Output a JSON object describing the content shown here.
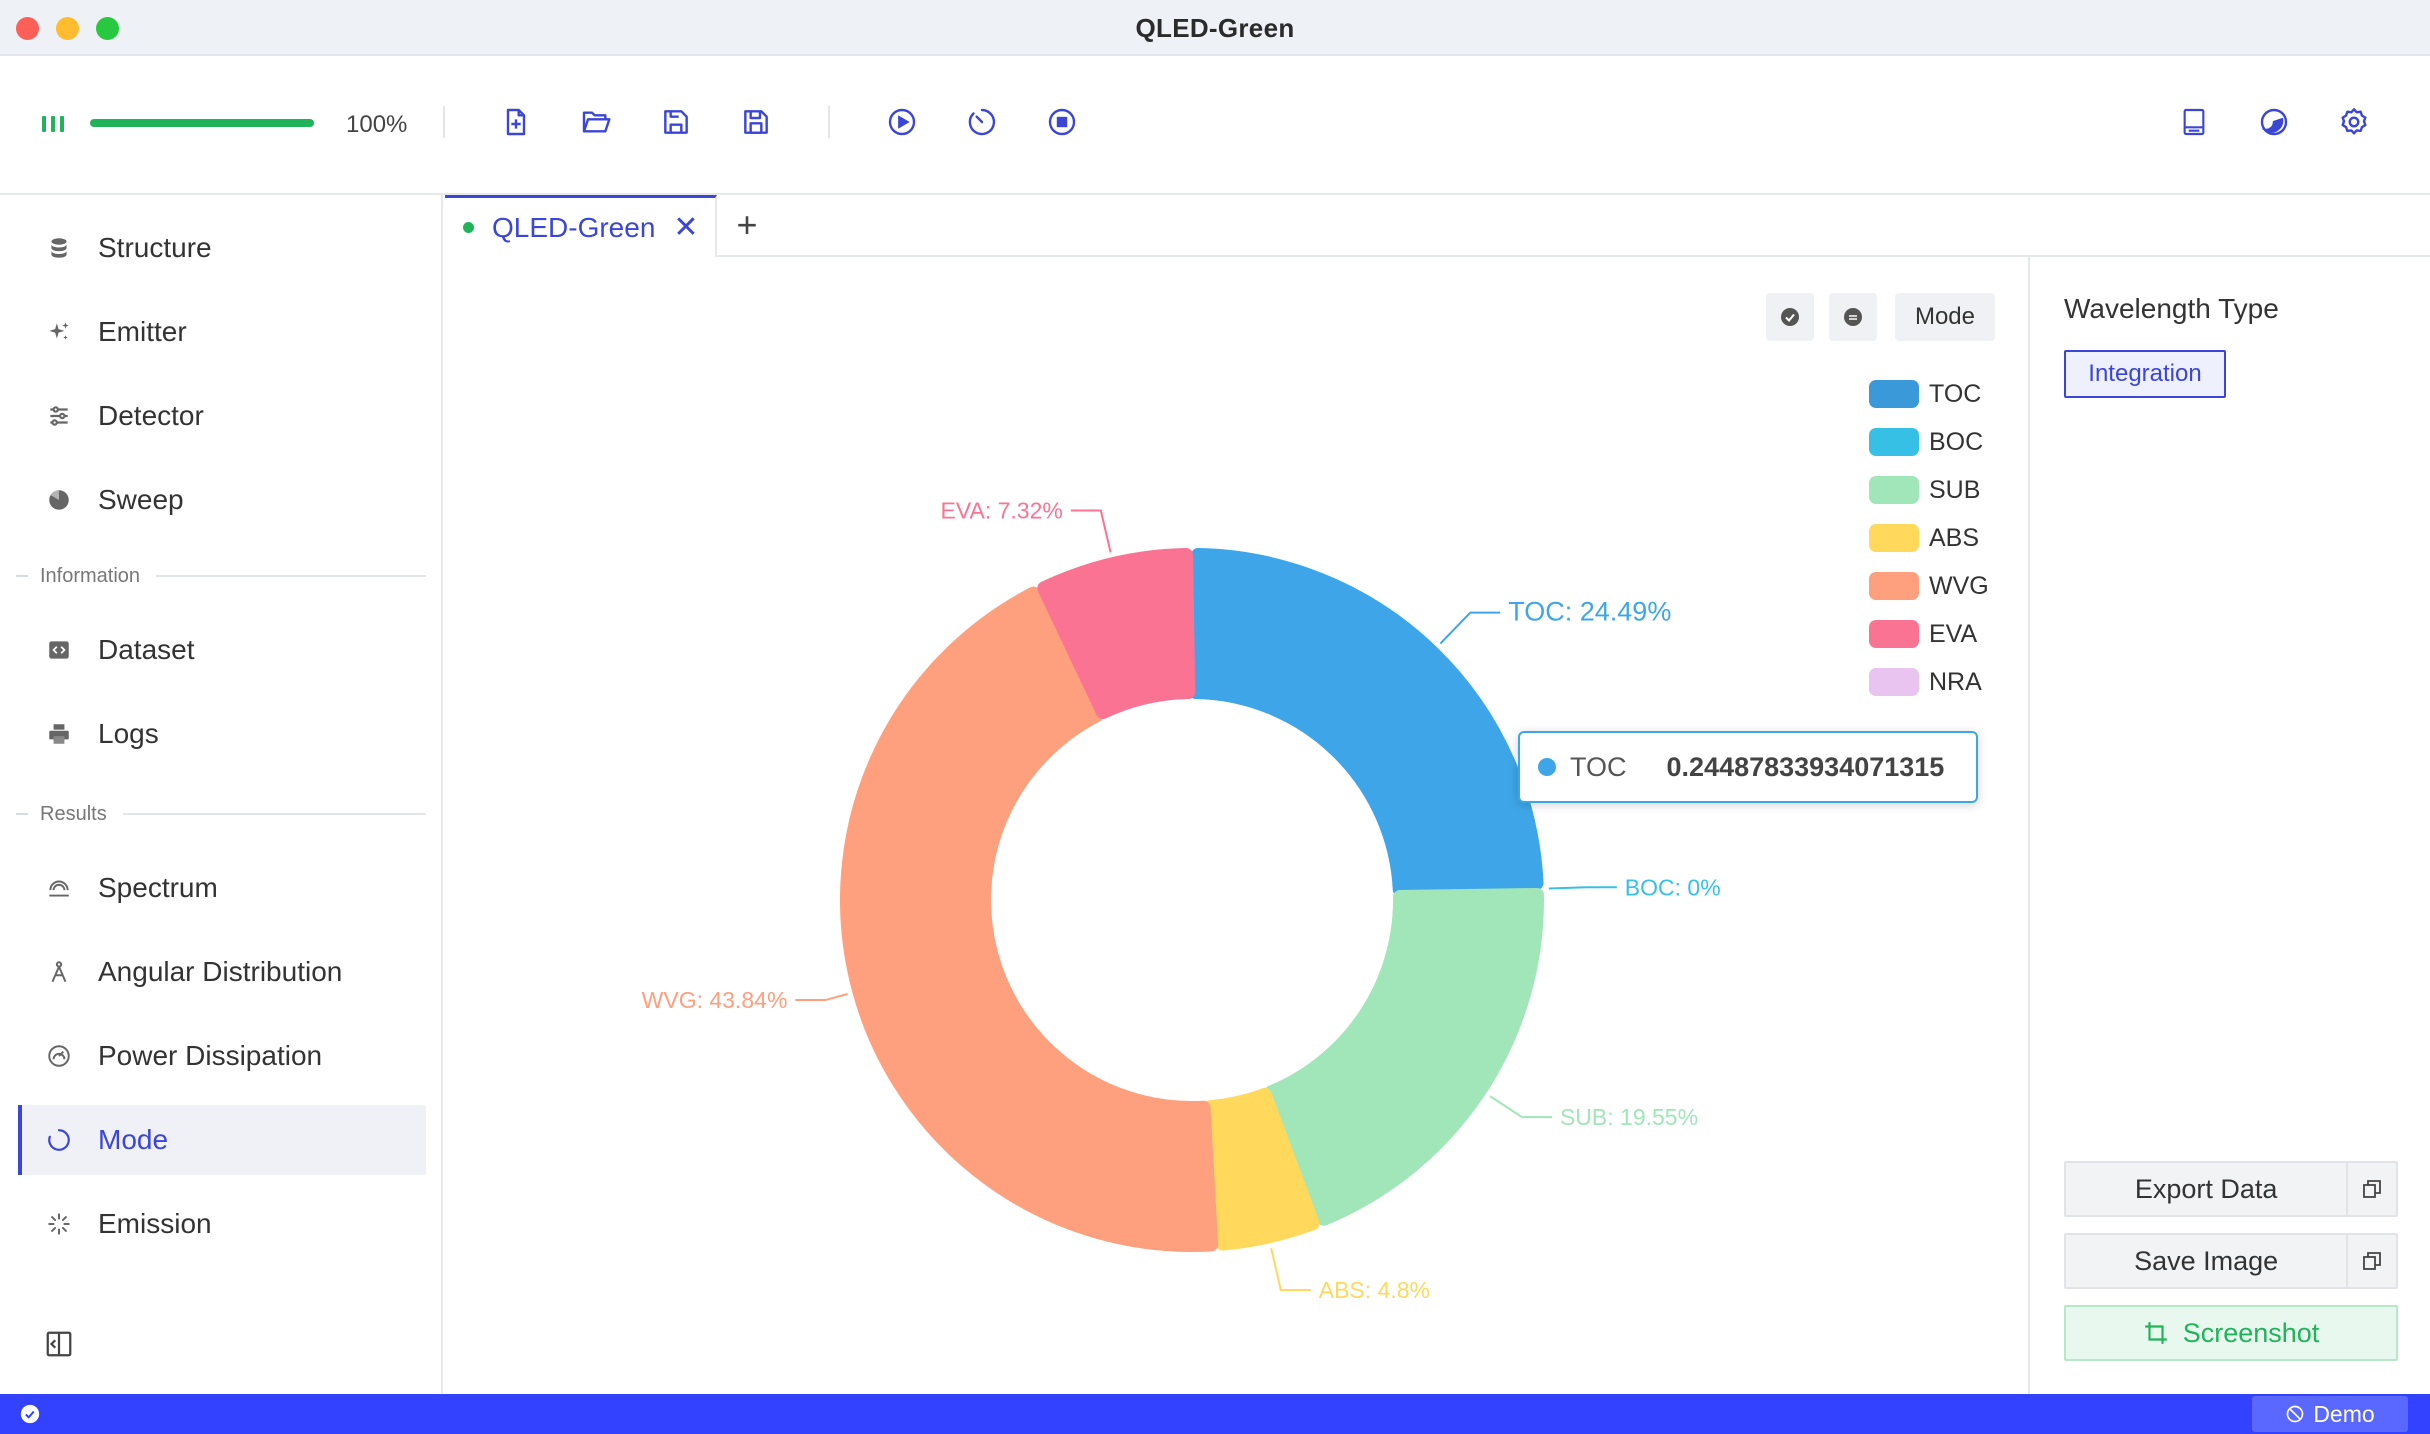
{
  "window": {
    "title": "QLED-Green"
  },
  "toolbar": {
    "progress_value": 1.0,
    "progress_text": "100%",
    "buttons": [
      "new-file",
      "open-folder",
      "save",
      "save-as",
      "run",
      "timer",
      "stop"
    ],
    "right_buttons": [
      "book",
      "theme",
      "settings"
    ]
  },
  "sidebar": {
    "items": [
      {
        "label": "Structure",
        "icon": "database-icon"
      },
      {
        "label": "Emitter",
        "icon": "sparkle-icon"
      },
      {
        "label": "Detector",
        "icon": "sliders-icon"
      },
      {
        "label": "Sweep",
        "icon": "pie-icon"
      }
    ],
    "section_info": "Information",
    "info_items": [
      {
        "label": "Dataset",
        "icon": "code-file-icon"
      },
      {
        "label": "Logs",
        "icon": "printer-icon"
      }
    ],
    "section_results": "Results",
    "result_items": [
      {
        "label": "Spectrum",
        "icon": "spectrum-icon"
      },
      {
        "label": "Angular Distribution",
        "icon": "compass-icon"
      },
      {
        "label": "Power Dissipation",
        "icon": "gauge-icon"
      },
      {
        "label": "Mode",
        "icon": "circle-loader-icon"
      },
      {
        "label": "Emission",
        "icon": "burst-icon"
      }
    ]
  },
  "tabs": {
    "active_label": "QLED-Green",
    "close": "✕",
    "add": "+"
  },
  "chart_controls": {
    "mode_label": "Mode"
  },
  "colors": {
    "accent": "#3b46d6",
    "success": "#21b35a",
    "statusbar": "#3242ff",
    "TOC": "#3ea6e8",
    "BOC": "#36c0e6",
    "SUB": "#a1e6b9",
    "ABS": "#ffd85c",
    "WVG": "#fe9f7d",
    "EVA": "#fb7392",
    "NRA": "#e9c4f0"
  },
  "chart_data": {
    "type": "pie",
    "variant": "donut",
    "legend_position": "top-right",
    "slices": [
      {
        "name": "TOC",
        "value": 0.24487833934071315,
        "label": "TOC: 24.49%"
      },
      {
        "name": "BOC",
        "value": 0.0,
        "label": "BOC: 0%"
      },
      {
        "name": "SUB",
        "value": 0.1955,
        "label": "SUB: 19.55%"
      },
      {
        "name": "ABS",
        "value": 0.048,
        "label": "ABS: 4.8%"
      },
      {
        "name": "WVG",
        "value": 0.4384,
        "label": "WVG: 43.84%"
      },
      {
        "name": "EVA",
        "value": 0.0732,
        "label": "EVA: 7.32%"
      },
      {
        "name": "NRA",
        "value": 0.0,
        "label": ""
      }
    ],
    "legend": [
      "TOC",
      "BOC",
      "SUB",
      "ABS",
      "WVG",
      "EVA",
      "NRA"
    ]
  },
  "tooltip": {
    "name": "TOC",
    "value": "0.24487833934071315"
  },
  "right_panel": {
    "title": "Wavelength Type",
    "tag": "Integration",
    "export_label": "Export Data",
    "save_label": "Save Image",
    "screenshot_label": "Screenshot"
  },
  "statusbar": {
    "demo_label": "Demo"
  }
}
